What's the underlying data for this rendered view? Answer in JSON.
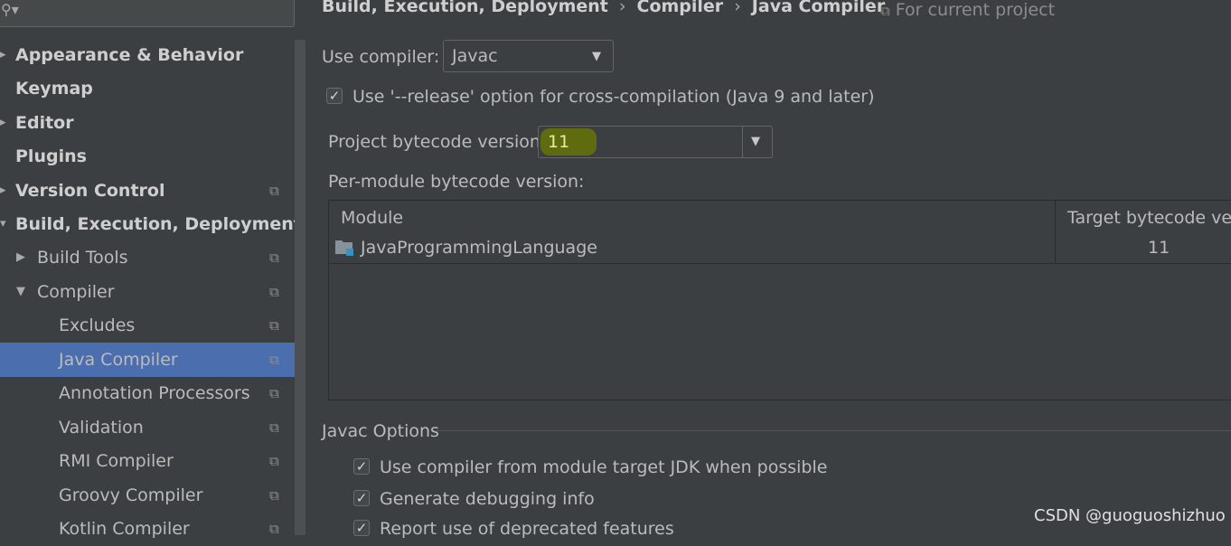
{
  "sidebar": {
    "items": [
      {
        "label": "Appearance & Behavior",
        "bold": true,
        "arrow": "right"
      },
      {
        "label": "Keymap",
        "bold": true
      },
      {
        "label": "Editor",
        "bold": true,
        "arrow": "right"
      },
      {
        "label": "Plugins",
        "bold": true
      },
      {
        "label": "Version Control",
        "bold": true,
        "arrow": "right"
      },
      {
        "label": "Build, Execution, Deployment",
        "bold": true,
        "arrow": "down"
      },
      {
        "label": "Build Tools",
        "arrow": "right"
      },
      {
        "label": "Compiler",
        "arrow": "down"
      },
      {
        "label": "Excludes"
      },
      {
        "label": "Java Compiler",
        "selected": true
      },
      {
        "label": "Annotation Processors"
      },
      {
        "label": "Validation"
      },
      {
        "label": "RMI Compiler"
      },
      {
        "label": "Groovy Compiler"
      },
      {
        "label": "Kotlin Compiler"
      }
    ]
  },
  "breadcrumb": [
    "Build, Execution, Deployment",
    "Compiler",
    "Java Compiler"
  ],
  "for_project": "For current project",
  "use_compiler": {
    "label": "Use compiler:",
    "value": "Javac"
  },
  "release_option": {
    "label": "Use '--release' option for cross-compilation (Java 9 and later)",
    "checked": true
  },
  "bytecode": {
    "label": "Project bytecode version:",
    "value": "11"
  },
  "per_module": {
    "label": "Per-module bytecode version:",
    "columns": [
      "Module",
      "Target bytecode vers"
    ],
    "rows": [
      {
        "module": "JavaProgrammingLanguage",
        "target": "11"
      }
    ]
  },
  "javac_options": {
    "title": "Javac Options",
    "options": [
      {
        "label": "Use compiler from module target JDK when possible",
        "checked": true
      },
      {
        "label": "Generate debugging info",
        "checked": true
      },
      {
        "label": "Report use of deprecated features",
        "checked": true
      }
    ]
  },
  "watermark": "CSDN @guoguoshizhuo",
  "colors": {
    "background": "#3c3f41",
    "selection": "#4b6eaf",
    "highlight": "#5e6b0f"
  }
}
